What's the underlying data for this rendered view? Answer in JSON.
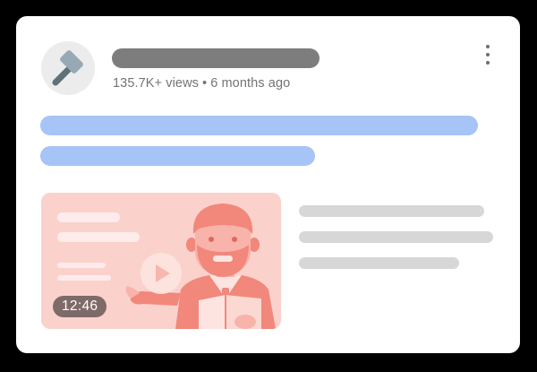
{
  "post": {
    "views": "135.7K+ views",
    "separator": "•",
    "age": "6 months ago"
  },
  "video": {
    "duration": "12:46"
  },
  "icons": {
    "avatar": "hammer-icon",
    "menu": "more-vert-icon",
    "play": "play-icon"
  },
  "colors": {
    "background": "#000000",
    "card": "#ffffff",
    "title_placeholder": "#7d7d7d",
    "text_placeholder": "#a6c4f5",
    "thumbnail": "#fbd1cc",
    "figure": "#f2877b",
    "description_placeholder": "#d7d7d7"
  }
}
